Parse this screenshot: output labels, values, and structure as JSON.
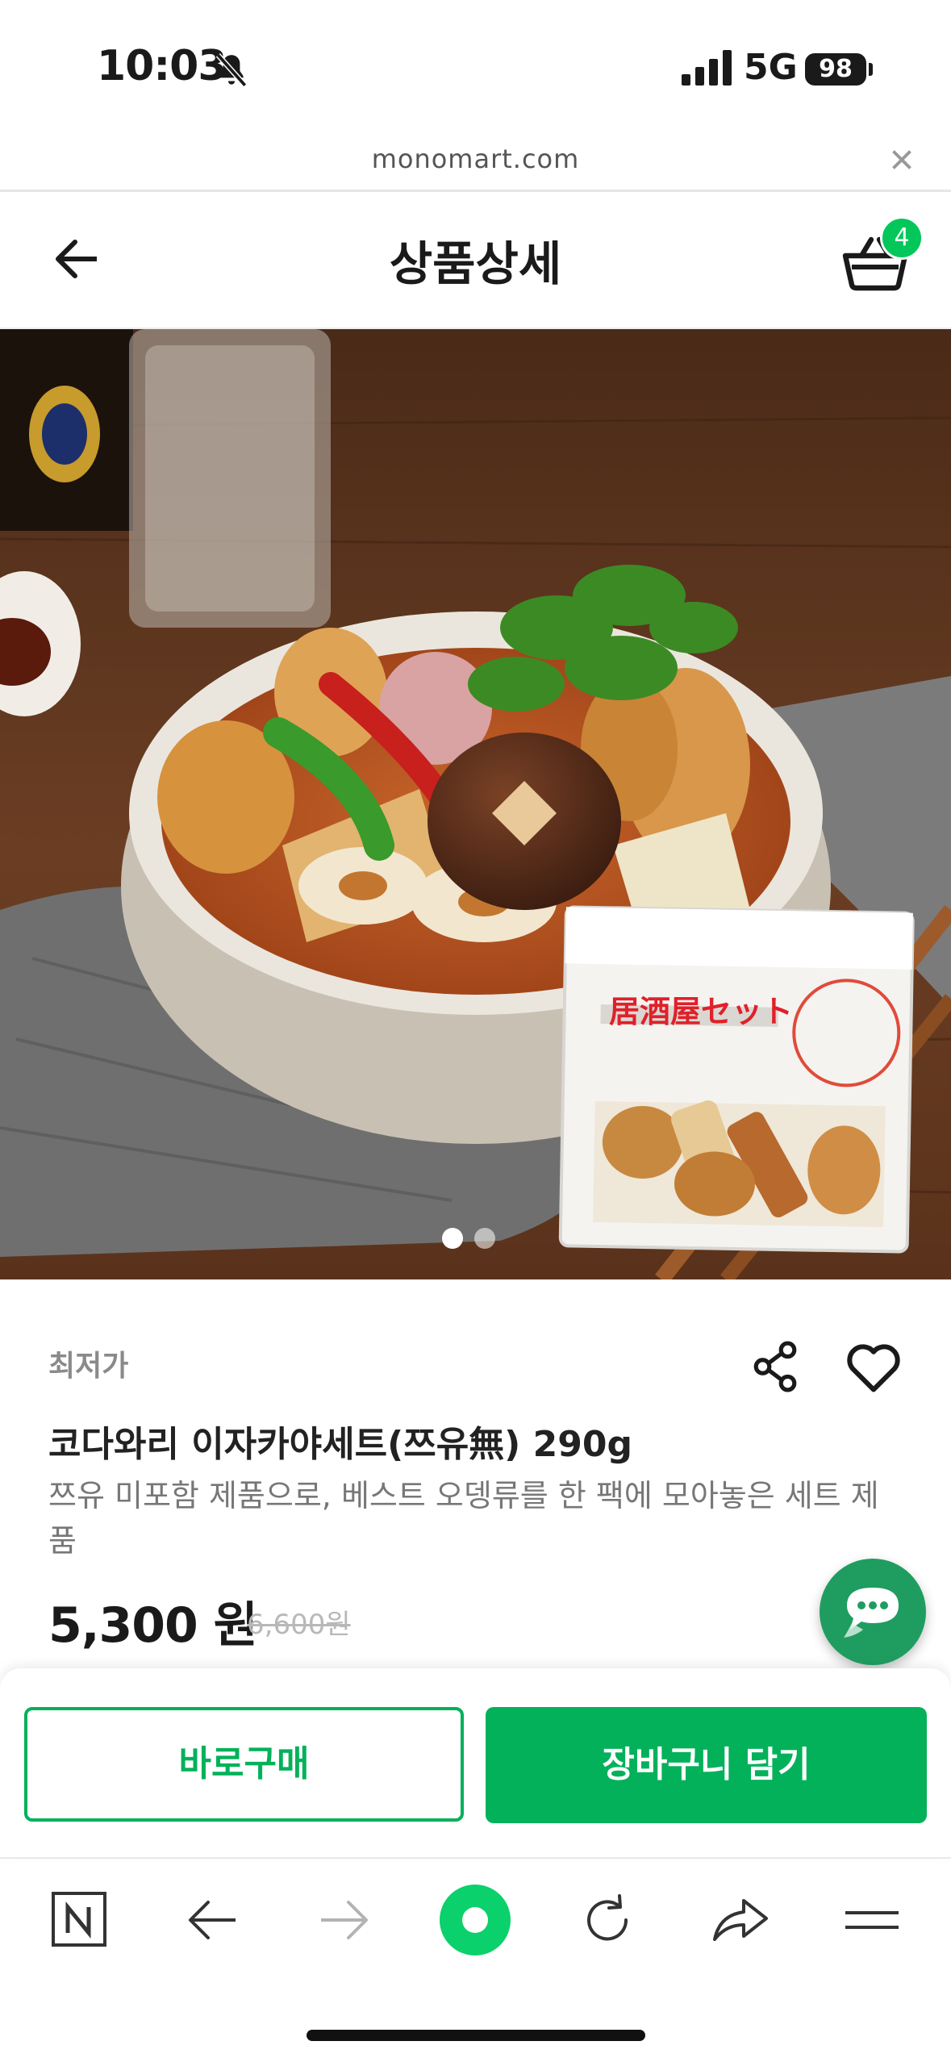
{
  "status_bar": {
    "time": "10:03",
    "network": "5G",
    "battery": "98"
  },
  "browser": {
    "url": "monomart.com"
  },
  "header": {
    "title": "상품상세",
    "cart_count": "4"
  },
  "gallery": {
    "total_images": 2,
    "current_index": 1,
    "package_label": "居酒屋セット"
  },
  "product": {
    "badge": "최저가",
    "name": "코다와리 이자카야세트(쯔유無) 290g",
    "description": "쯔유 미포함 제품으로, 베스트 오뎅류를 한 팩에 모아놓은 세트 제품",
    "price": "5,300 원",
    "original_price": "6,600원"
  },
  "actions": {
    "buy_now": "바로구매",
    "add_to_cart": "장바구니 담기"
  },
  "colors": {
    "accent": "#03b15a",
    "badge": "#03c75a",
    "chat": "#1f9d60"
  },
  "icons": [
    "bell-slash-icon",
    "signal-icon",
    "close-icon",
    "arrow-left-icon",
    "basket-icon",
    "share-icon",
    "heart-icon",
    "chat-icon",
    "naver-n-icon",
    "arrow-right-icon",
    "green-dot-icon",
    "refresh-icon",
    "share-arrow-icon",
    "menu-icon"
  ]
}
